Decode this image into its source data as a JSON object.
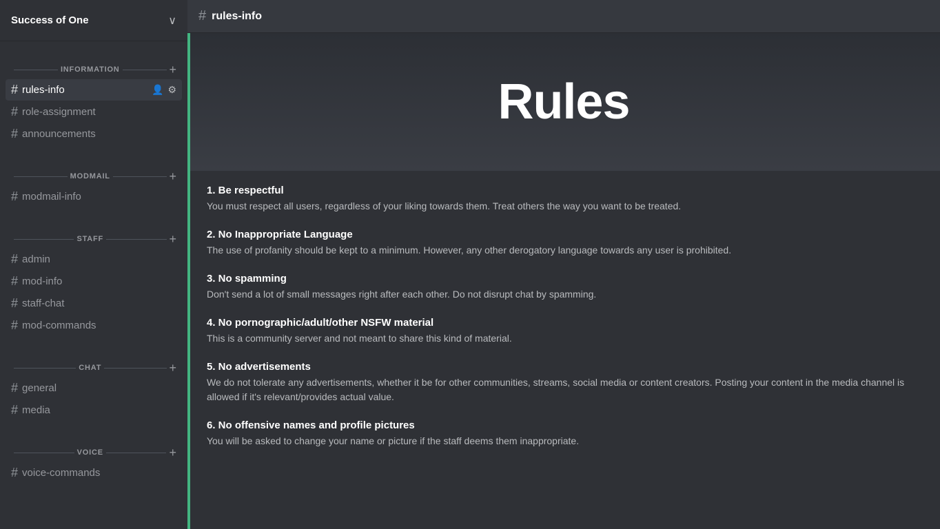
{
  "server": {
    "title": "Success of One",
    "chevron": "∨"
  },
  "header": {
    "hash": "#",
    "channel_name": "rules-info"
  },
  "banner": {
    "title": "Rules"
  },
  "sections": [
    {
      "id": "information",
      "label": "INFORMATION",
      "channels": [
        {
          "id": "rules-info",
          "name": "rules-info",
          "active": true
        },
        {
          "id": "role-assignment",
          "name": "role-assignment",
          "active": false
        },
        {
          "id": "announcements",
          "name": "announcements",
          "active": false
        }
      ]
    },
    {
      "id": "modmail",
      "label": "MODMAIL",
      "channels": [
        {
          "id": "modmail-info",
          "name": "modmail-info",
          "active": false
        }
      ]
    },
    {
      "id": "staff",
      "label": "STAFF",
      "channels": [
        {
          "id": "admin",
          "name": "admin",
          "active": false
        },
        {
          "id": "mod-info",
          "name": "mod-info",
          "active": false
        },
        {
          "id": "staff-chat",
          "name": "staff-chat",
          "active": false
        },
        {
          "id": "mod-commands",
          "name": "mod-commands",
          "active": false
        }
      ]
    },
    {
      "id": "chat",
      "label": "CHAT",
      "channels": [
        {
          "id": "general",
          "name": "general",
          "active": false
        },
        {
          "id": "media",
          "name": "media",
          "active": false
        }
      ]
    },
    {
      "id": "voice",
      "label": "VOICE",
      "channels": [
        {
          "id": "voice-commands",
          "name": "voice-commands",
          "active": false
        }
      ]
    }
  ],
  "rules": [
    {
      "id": "rule-1",
      "title": "1. Be respectful",
      "body": "You must respect all users, regardless of your liking towards them. Treat others the way you want to be treated."
    },
    {
      "id": "rule-2",
      "title": "2. No Inappropriate Language",
      "body": "The use of profanity should be kept to a minimum. However, any other derogatory language towards any user is prohibited."
    },
    {
      "id": "rule-3",
      "title": "3. No spamming",
      "body": "Don't send a lot of small messages right after each other. Do not disrupt chat by spamming."
    },
    {
      "id": "rule-4",
      "title": "4. No pornographic/adult/other NSFW material",
      "body": "This is a community server and not meant to share this kind of material."
    },
    {
      "id": "rule-5",
      "title": "5. No advertisements",
      "body": "We do not tolerate any advertisements, whether it be for other communities, streams, social media or content creators. Posting your content in the media channel is allowed if it's relevant/provides actual value."
    },
    {
      "id": "rule-6",
      "title": "6. No offensive names and profile pictures",
      "body": "You will be asked to change your name or picture if the staff deems them inappropriate."
    }
  ],
  "icons": {
    "hash": "#",
    "add": "+",
    "add_user": "👤+",
    "settings": "⚙"
  }
}
